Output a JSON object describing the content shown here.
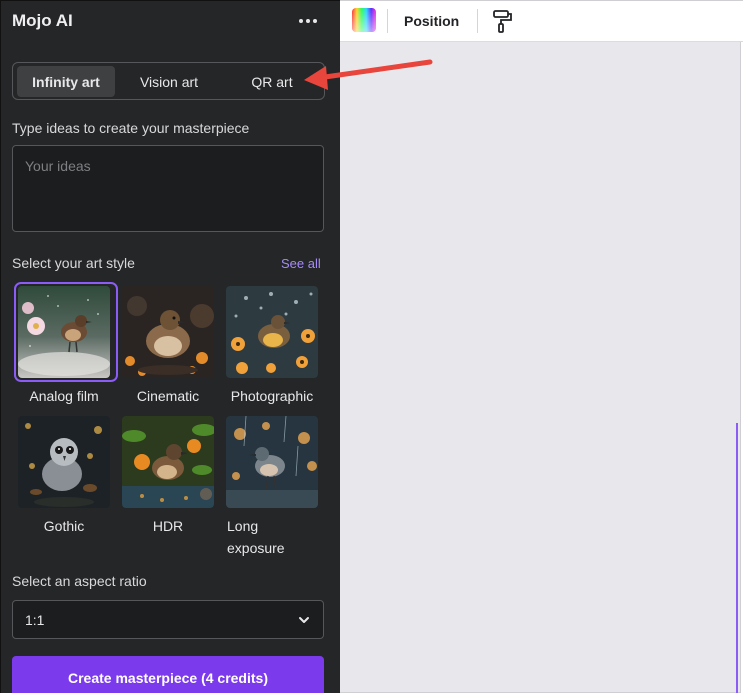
{
  "panel": {
    "title": "Mojo AI",
    "more_icon": "more-horizontal-icon",
    "tabs": [
      {
        "label": "Infinity art",
        "active": true
      },
      {
        "label": "Vision art",
        "active": false
      },
      {
        "label": "QR art",
        "active": false
      }
    ],
    "prompt": {
      "label": "Type ideas to create your masterpiece",
      "placeholder": "Your ideas",
      "value": ""
    },
    "styles": {
      "label": "Select your art style",
      "see_all": "See all",
      "items": [
        {
          "label": "Analog film",
          "selected": true
        },
        {
          "label": "Cinematic",
          "selected": false
        },
        {
          "label": "Photographic",
          "selected": false
        },
        {
          "label": "Gothic",
          "selected": false
        },
        {
          "label": "HDR",
          "selected": false
        },
        {
          "label": "Long exposure",
          "selected": false
        }
      ]
    },
    "aspect": {
      "label": "Select an aspect ratio",
      "value": "1:1"
    },
    "create_button": "Create masterpiece (4 credits)"
  },
  "toolbar": {
    "color_icon": "color-picker-icon",
    "position_label": "Position",
    "paint_icon": "paint-roller-icon"
  },
  "colors": {
    "panel_bg": "#252627",
    "accent": "#7c3aed",
    "link": "#a58bf7",
    "canvas_bg": "#e8e8ec",
    "annotation": "#e8453c"
  }
}
